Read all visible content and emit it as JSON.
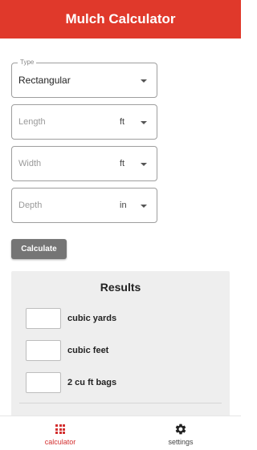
{
  "app": {
    "title": "Mulch Calculator"
  },
  "form": {
    "type": {
      "legend": "Type",
      "value": "Rectangular"
    },
    "length": {
      "placeholder": "Length",
      "unit": "ft"
    },
    "width": {
      "placeholder": "Width",
      "unit": "ft"
    },
    "depth": {
      "placeholder": "Depth",
      "unit": "in"
    },
    "calculate_label": "Calculate"
  },
  "results": {
    "title": "Results",
    "rows": [
      {
        "label": "cubic yards",
        "value": ""
      },
      {
        "label": "cubic feet",
        "value": ""
      },
      {
        "label": "2 cu ft bags",
        "value": ""
      }
    ]
  },
  "nav": {
    "items": [
      {
        "label": "calculator",
        "icon": "grid-icon",
        "active": true
      },
      {
        "label": "settings",
        "icon": "gear-icon",
        "active": false
      }
    ]
  },
  "colors": {
    "app_bar": "#e0392b",
    "accent": "#d32f2f",
    "button": "#757575"
  }
}
